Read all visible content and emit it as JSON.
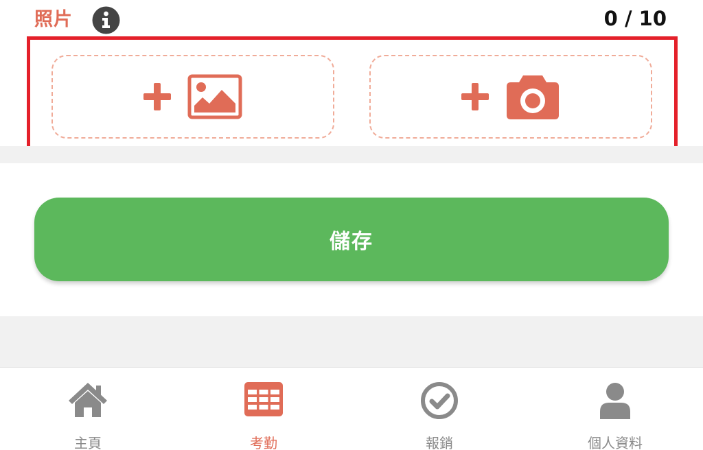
{
  "header": {
    "title": "照片",
    "info_icon": "info-circle-icon",
    "count": "0 / 10"
  },
  "upload": {
    "gallery": {
      "icons": [
        "plus-icon",
        "image-icon"
      ]
    },
    "camera": {
      "icons": [
        "plus-icon",
        "camera-icon"
      ]
    }
  },
  "save_button": {
    "label": "儲存"
  },
  "bottom_nav": {
    "items": [
      {
        "label": "主頁",
        "icon": "home-icon",
        "active": false
      },
      {
        "label": "考勤",
        "icon": "calendar-grid-icon",
        "active": true
      },
      {
        "label": "報銷",
        "icon": "check-circle-icon",
        "active": false
      },
      {
        "label": "個人資料",
        "icon": "user-icon",
        "active": false
      }
    ]
  },
  "colors": {
    "accent": "#e06c57",
    "highlight_border": "#e4202a",
    "dashed_border": "#f0ab98",
    "save_green": "#5cb85c",
    "nav_inactive": "#8a8a8a",
    "background_band": "#f1f1f1"
  }
}
